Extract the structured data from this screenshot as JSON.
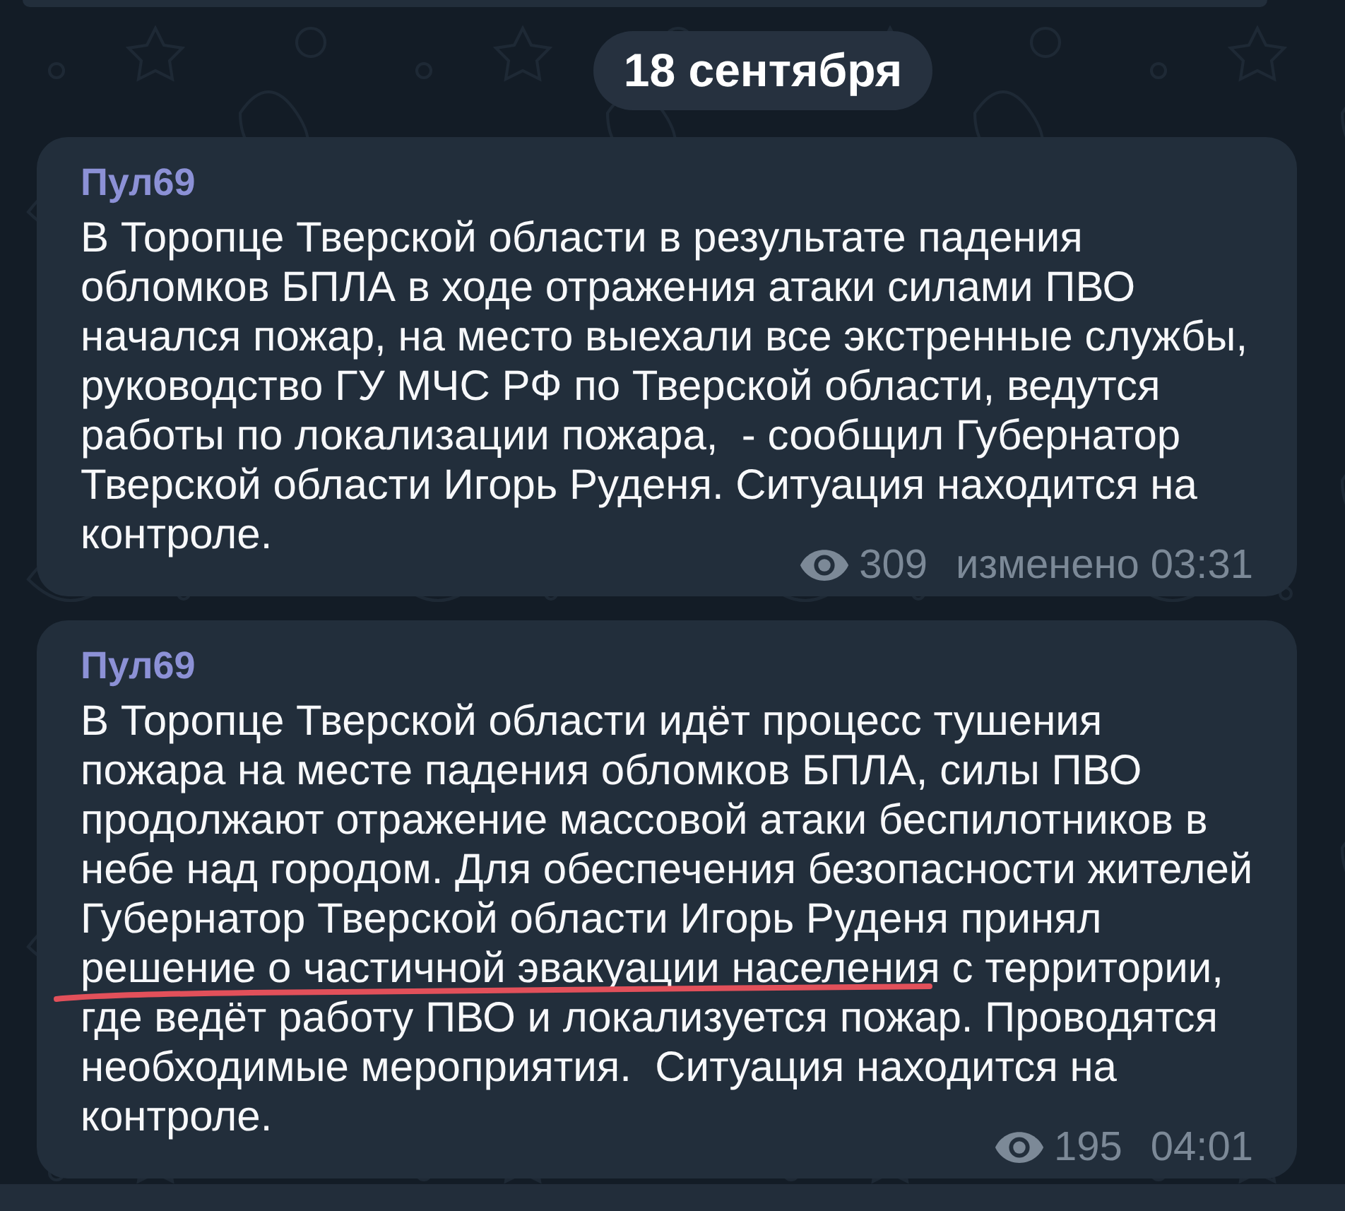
{
  "date_badge": "18 сентября",
  "messages": [
    {
      "author": "Пул69",
      "text": "В Торопце Тверской области в результате падения обломков БПЛА в ходе отражения атаки силами ПВО начался пожар, на место выехали все экстренные службы, руководство ГУ МЧС РФ по Тверской области, ведутся работы по локализации пожара,  - сообщил Губернатор Тверской области Игорь Руденя. Ситуация находится на контроле.",
      "views": "309",
      "timestamp": "изменено 03:31",
      "underlined": false
    },
    {
      "author": "Пул69",
      "text": "В Торопце Тверской области идёт процесс тушения пожара на месте падения обломков БПЛА, силы ПВО продолжают отражение массовой атаки беспилотников в небе над городом. Для обеспечения безопасности жителей Губернатор Тверской области Игорь Руденя принял решение о частичной эвакуации населения с территории, где ведёт работу ПВО и локализуется пожар. Проводятся необходимые мероприятия.  Ситуация находится на контроле.",
      "views": "195",
      "timestamp": "04:01",
      "underlined": true
    }
  ]
}
